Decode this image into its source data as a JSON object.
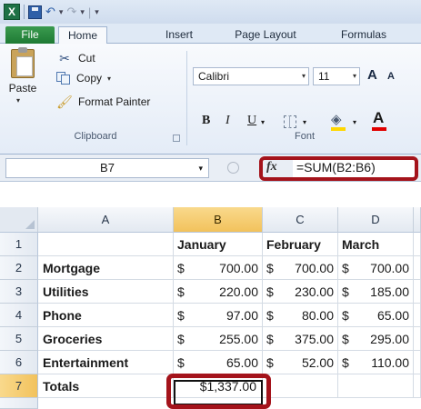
{
  "app": {
    "logo_letter": "X",
    "accent_color": "#1e7145",
    "highlight_color": "#a4131b"
  },
  "quick_access": {
    "icons": [
      "excel-logo-icon",
      "save-icon",
      "undo-icon",
      "redo-icon",
      "customize-caret-icon"
    ],
    "undo_glyph": "↶",
    "redo_glyph": "↷",
    "caret": "▾",
    "pipe": "|"
  },
  "ribbon_tabs": [
    "File",
    "Home",
    "Insert",
    "Page Layout",
    "Formulas"
  ],
  "clipboard": {
    "paste": "Paste",
    "cut": "Cut",
    "copy": "Copy",
    "format_painter": "Format Painter",
    "group_label": "Clipboard"
  },
  "font": {
    "name": "Calibri",
    "size": "11",
    "grow_glyph": "A",
    "bold": "B",
    "italic": "I",
    "underline": "U",
    "font_color_glyph": "A",
    "group_label": "Font",
    "caret": "▾"
  },
  "formula_bar": {
    "name_box": "B7",
    "fx": "fx",
    "formula": "=SUM(B2:B6)"
  },
  "grid": {
    "selected_column": "B",
    "selected_row": "7",
    "columns": [
      "A",
      "B",
      "C",
      "D"
    ],
    "rows": [
      {
        "num": "1",
        "a": "",
        "b": "January",
        "c": "February",
        "d": "March"
      },
      {
        "num": "2",
        "a": "Mortgage",
        "b": [
          "$",
          "700.00"
        ],
        "c": [
          "$",
          "700.00"
        ],
        "d": [
          "$",
          "700.00"
        ]
      },
      {
        "num": "3",
        "a": "Utilities",
        "b": [
          "$",
          "220.00"
        ],
        "c": [
          "$",
          "230.00"
        ],
        "d": [
          "$",
          "185.00"
        ]
      },
      {
        "num": "4",
        "a": "Phone",
        "b": [
          "$",
          "97.00"
        ],
        "c": [
          "$",
          "80.00"
        ],
        "d": [
          "$",
          "65.00"
        ]
      },
      {
        "num": "5",
        "a": "Groceries",
        "b": [
          "$",
          "255.00"
        ],
        "c": [
          "$",
          "375.00"
        ],
        "d": [
          "$",
          "295.00"
        ]
      },
      {
        "num": "6",
        "a": "Entertainment",
        "b": [
          "$",
          "65.00"
        ],
        "c": [
          "$",
          "52.00"
        ],
        "d": [
          "$",
          "110.00"
        ]
      },
      {
        "num": "7",
        "a": "Totals",
        "b": "$1,337.00",
        "c": "",
        "d": ""
      }
    ]
  }
}
